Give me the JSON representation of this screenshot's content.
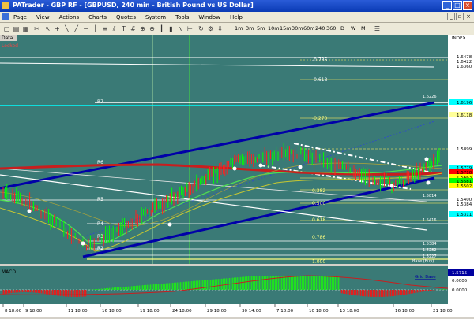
{
  "window": {
    "title": "PATrader - GBP RF - [GBPUSD, 240 min - British Pound vs US Dollar]"
  },
  "menu": {
    "items": [
      "Page",
      "View",
      "Actions",
      "Charts",
      "Quotes",
      "System",
      "Tools",
      "Window",
      "Help"
    ]
  },
  "toolbar": {
    "timeframes": [
      "1m",
      "3m",
      "5m",
      "10m",
      "15m",
      "30m",
      "60m",
      "240",
      "360"
    ],
    "periods": [
      "D",
      "W",
      "M"
    ]
  },
  "panel": {
    "data_label": "Data",
    "locked_label": "Locked",
    "index_label": "INDEX"
  },
  "price_axis": {
    "labels": [
      "1.6478",
      "1.6422",
      "1.6360",
      "1.6196",
      "1.6118",
      "1.5899",
      "1.5779",
      "1.5710",
      "1.5663",
      "1.5581",
      "1.5502",
      "1.5400",
      "1.5384",
      "1.5311"
    ],
    "box_colors": [
      "#ffffff",
      "#ffffff",
      "#ffffff",
      "#00ffff",
      "#ffff99",
      "#ffffff",
      "#00ffff",
      "#ff0000",
      "#ffff00",
      "#00ff00",
      "#ffff00",
      "#ffffff",
      "#ffffff",
      "#00ffff"
    ]
  },
  "fib_labels": [
    "-0.786",
    "-0.618",
    "-0.270",
    "0.382",
    "0.500",
    "0.618",
    "0.786",
    "1.000"
  ],
  "fib_values": [
    "1.6226",
    "1.5814",
    "1.5416",
    "1.5384",
    "1.5282",
    "1.5227"
  ],
  "channel_labels": [
    "R7",
    "R6",
    "R5",
    "R4",
    "R3",
    "R2"
  ],
  "base_label": "Base (Buy)",
  "macd": {
    "title": "MACD",
    "scale_labels": [
      "1.5715",
      "0.0005",
      "0.0000"
    ],
    "right_label": "Grid Base"
  },
  "time_axis": {
    "labels": [
      "8 18:00",
      "9 18:00",
      "11 18:00",
      "16 18:00",
      "19 18:00",
      "24 18:00",
      "29 18:00",
      "30 14:00",
      "7 18:00",
      "10 18:00",
      "13 18:00",
      "16 18:00",
      "21 18:00"
    ]
  },
  "colors": {
    "chart_bg": "#3a7a76",
    "channel": "#0000a8",
    "wick_up": "#00ff00",
    "wick_down": "#ff2020",
    "ma_red": "#c81e1e"
  }
}
